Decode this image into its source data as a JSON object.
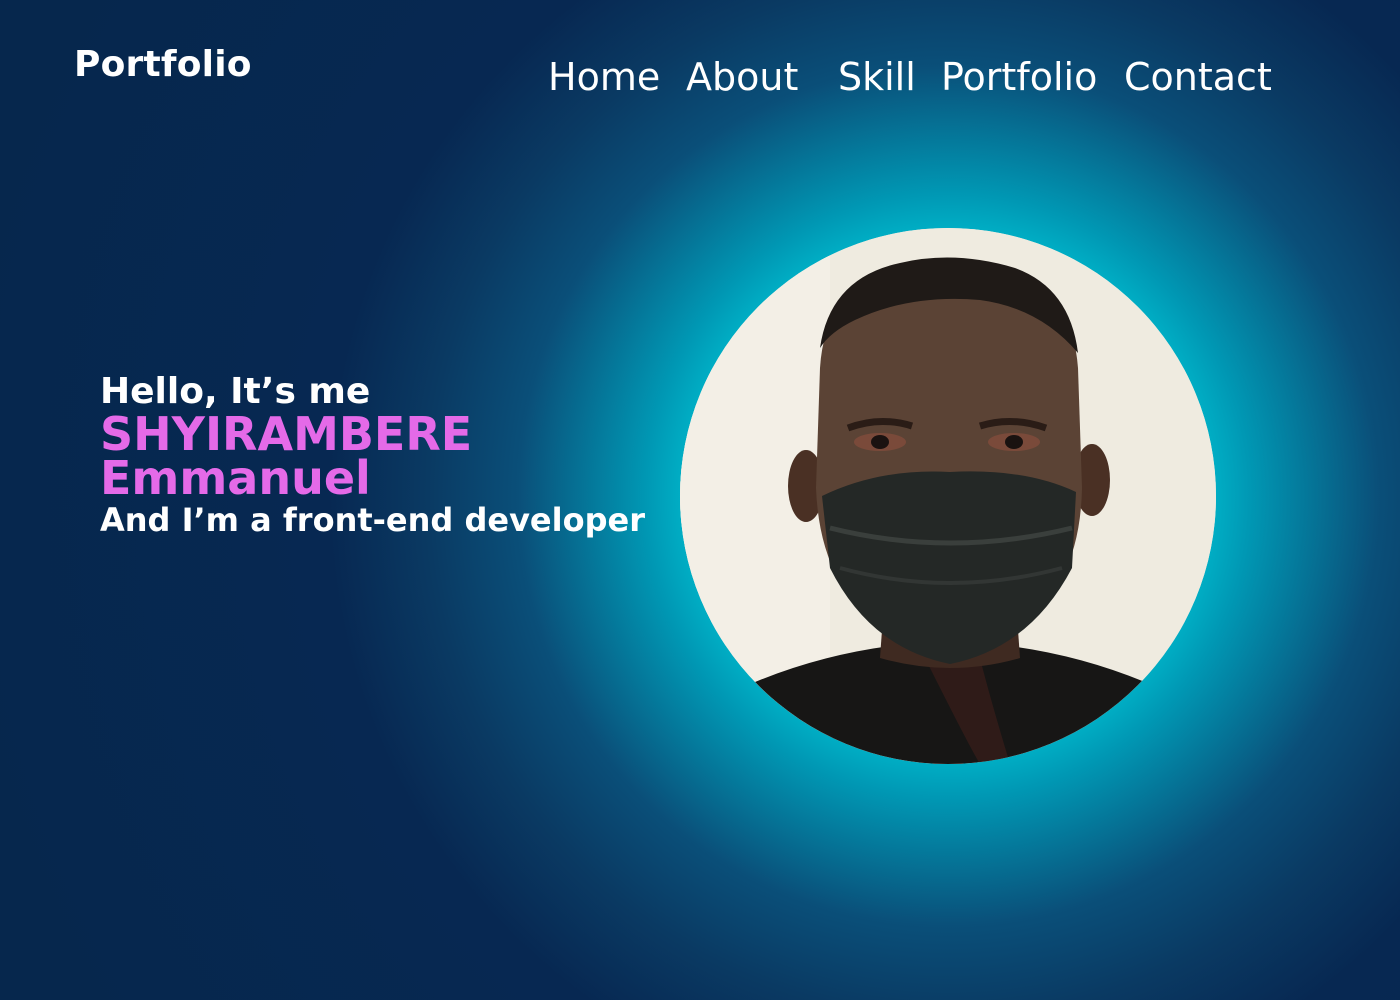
{
  "brand": {
    "logo_text": "Portfolio"
  },
  "nav": {
    "items": [
      {
        "label": "Home"
      },
      {
        "label": "About"
      },
      {
        "label": "Skill"
      },
      {
        "label": "Portfolio"
      },
      {
        "label": "Contact"
      }
    ]
  },
  "hero": {
    "greeting": "Hello, It’s me",
    "name_first": "SHYIRAMBERE",
    "name_last": "Emmanuel",
    "tagline": "And I’m a front-end developer"
  },
  "avatar": {
    "kind": "profile-photo"
  },
  "colors": {
    "background": "#062a4e",
    "glow": "#00c0d0",
    "accent_name": "#e46ae8",
    "text": "#ffffff"
  }
}
